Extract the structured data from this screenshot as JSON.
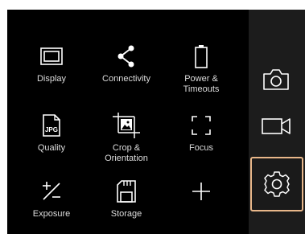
{
  "menu": {
    "items": [
      {
        "label": "Display",
        "icon": "display-icon"
      },
      {
        "label": "Connectivity",
        "icon": "share-icon"
      },
      {
        "label": "Power &\nTimeouts",
        "icon": "battery-icon"
      },
      {
        "label": "Quality",
        "icon": "jpg-file-icon"
      },
      {
        "label": "Crop &\nOrientation",
        "icon": "crop-icon"
      },
      {
        "label": "Focus",
        "icon": "focus-frame-icon"
      },
      {
        "label": "Exposure",
        "icon": "exposure-compensation-icon"
      },
      {
        "label": "Storage",
        "icon": "sd-card-icon"
      },
      {
        "label": "",
        "icon": "plus-icon"
      }
    ]
  },
  "side_panel": {
    "buttons": [
      {
        "icon": "camera-icon",
        "selected": false
      },
      {
        "icon": "video-camera-icon",
        "selected": false
      },
      {
        "icon": "gear-icon",
        "selected": true
      }
    ],
    "selected_border_color": "#e8b78a"
  }
}
